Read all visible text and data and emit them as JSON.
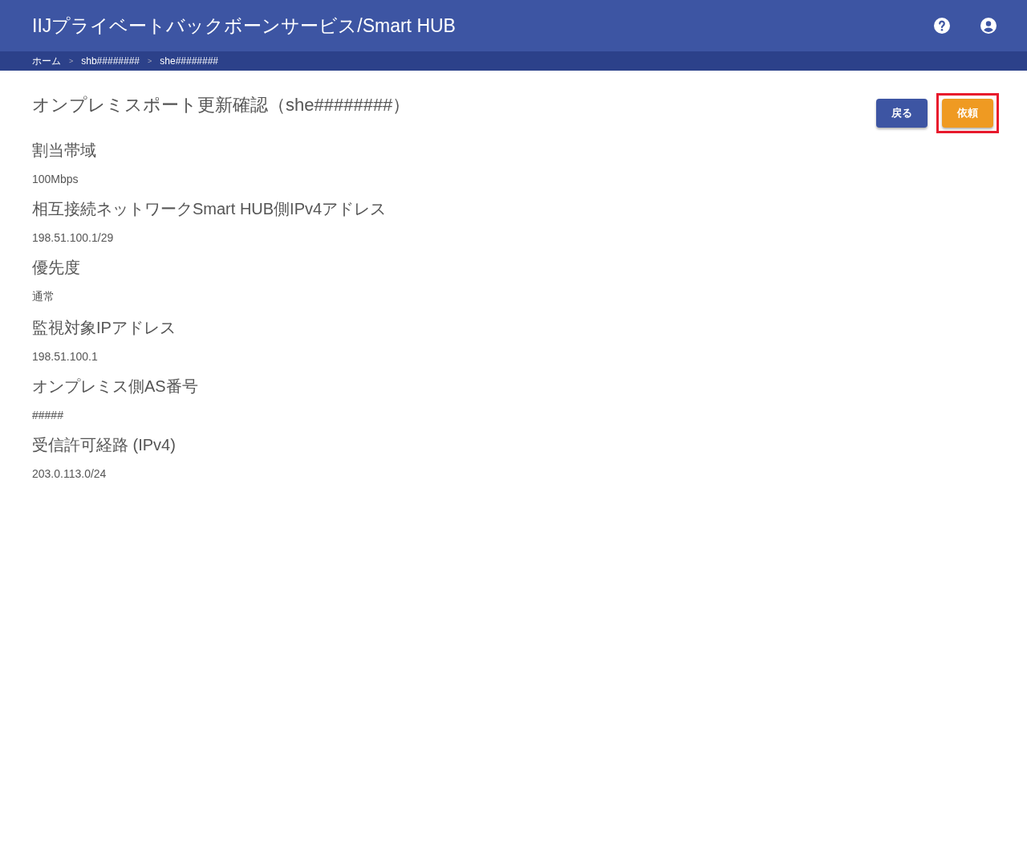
{
  "header": {
    "title": "IIJプライベートバックボーンサービス/Smart HUB"
  },
  "breadcrumb": [
    {
      "label": "ホーム",
      "separator": ">"
    },
    {
      "label": "shb########",
      "separator": ">"
    },
    {
      "label": "she########"
    }
  ],
  "page": {
    "title": "オンプレミスポート更新確認（she########）"
  },
  "buttons": [
    {
      "label": "戻る",
      "kind": "secondary",
      "highlighted": false
    },
    {
      "label": "依頼",
      "kind": "primary",
      "highlighted": true
    }
  ],
  "fields": [
    {
      "label": "割当帯域",
      "value": "100Mbps"
    },
    {
      "label": "相互接続ネットワークSmart HUB側IPv4アドレス",
      "value": "198.51.100.1/29"
    },
    {
      "label": "優先度",
      "value": "通常"
    },
    {
      "label": "監視対象IPアドレス",
      "value": "198.51.100.1"
    },
    {
      "label": "オンプレミス側AS番号",
      "value": "#####"
    },
    {
      "label": "受信許可経路 (IPv4)",
      "value": "203.0.113.0/24"
    }
  ]
}
